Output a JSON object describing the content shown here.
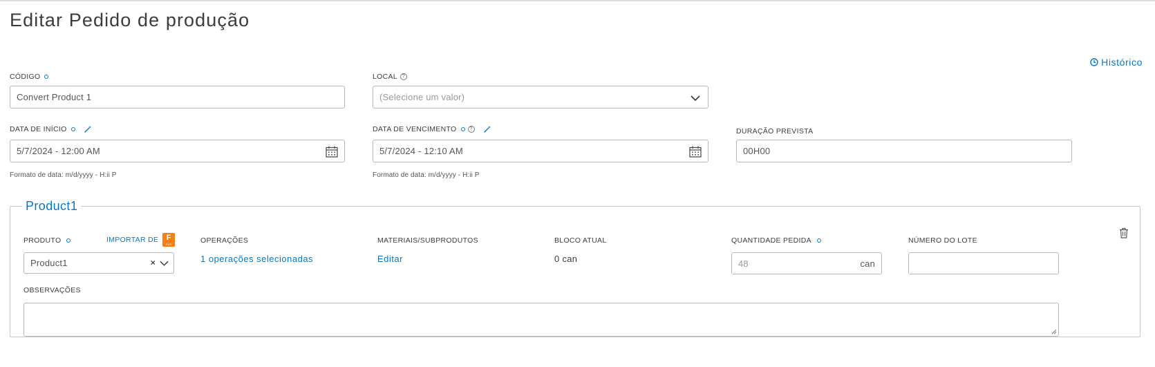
{
  "header": {
    "title": "Editar Pedido de produção",
    "history_label": "Histórico"
  },
  "form": {
    "codigo": {
      "label": "CÓDIGO",
      "value": "Convert Product 1"
    },
    "local": {
      "label": "LOCAL",
      "placeholder": "(Selecione um valor)"
    },
    "data_inicio": {
      "label": "DATA DE INÍCIO",
      "value": "5/7/2024 - 12:00 AM",
      "hint": "Formato de data: m/d/yyyy - H:ii P"
    },
    "data_vencimento": {
      "label": "DATA DE VENCIMENTO",
      "value": "5/7/2024 - 12:10 AM",
      "hint": "Formato de data: m/d/yyyy - H:ii P"
    },
    "duracao": {
      "label": "DURAÇÃO PREVISTA",
      "value": "00H00"
    }
  },
  "product_section": {
    "title": "Product1",
    "produto": {
      "label": "PRODUTO",
      "import_label": "IMPORTAR DE",
      "value": "Product1",
      "fusion_letter": "F",
      "fusion_sub": "FUS"
    },
    "operacoes": {
      "label": "OPERAÇÕES",
      "link": "1 operações selecionadas"
    },
    "materiais": {
      "label": "MATERIAIS/SUBPRODUTOS",
      "link": "Editar"
    },
    "bloco": {
      "label": "BLOCO ATUAL",
      "value": "0 can"
    },
    "quantidade": {
      "label": "QUANTIDADE PEDIDA",
      "value": "48",
      "unit": "can"
    },
    "lote": {
      "label": "NÚMERO DO LOTE",
      "value": ""
    },
    "observacoes": {
      "label": "OBSERVAÇÕES"
    }
  },
  "colors": {
    "accent": "#0a77c2",
    "fusion": "#f57f12",
    "border": "#b8b8b8"
  }
}
